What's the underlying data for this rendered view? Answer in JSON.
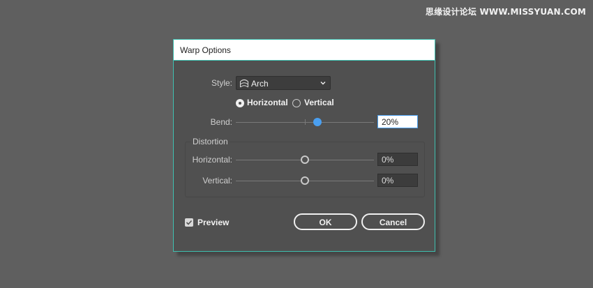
{
  "watermark": "思缘设计论坛 WWW.MISSYUAN.COM",
  "dialog": {
    "title": "Warp Options",
    "style": {
      "label": "Style:",
      "value": "Arch",
      "icon": "arch-warp-icon"
    },
    "orientation": {
      "options": [
        {
          "label": "Horizontal",
          "checked": true
        },
        {
          "label": "Vertical",
          "checked": false
        }
      ]
    },
    "bend": {
      "label": "Bend:",
      "value": "20%",
      "slider_value": 20
    },
    "distortion": {
      "group_label": "Distortion",
      "horizontal": {
        "label": "Horizontal:",
        "value": "0%",
        "slider_value": 0
      },
      "vertical": {
        "label": "Vertical:",
        "value": "0%",
        "slider_value": 0
      }
    },
    "preview": {
      "label": "Preview",
      "checked": true
    },
    "ok_label": "OK",
    "cancel_label": "Cancel"
  },
  "colors": {
    "background": "#5f5f5f",
    "dialog": "#505050",
    "accent_border": "#3fc1b1",
    "slider_active": "#4a9ff0"
  }
}
